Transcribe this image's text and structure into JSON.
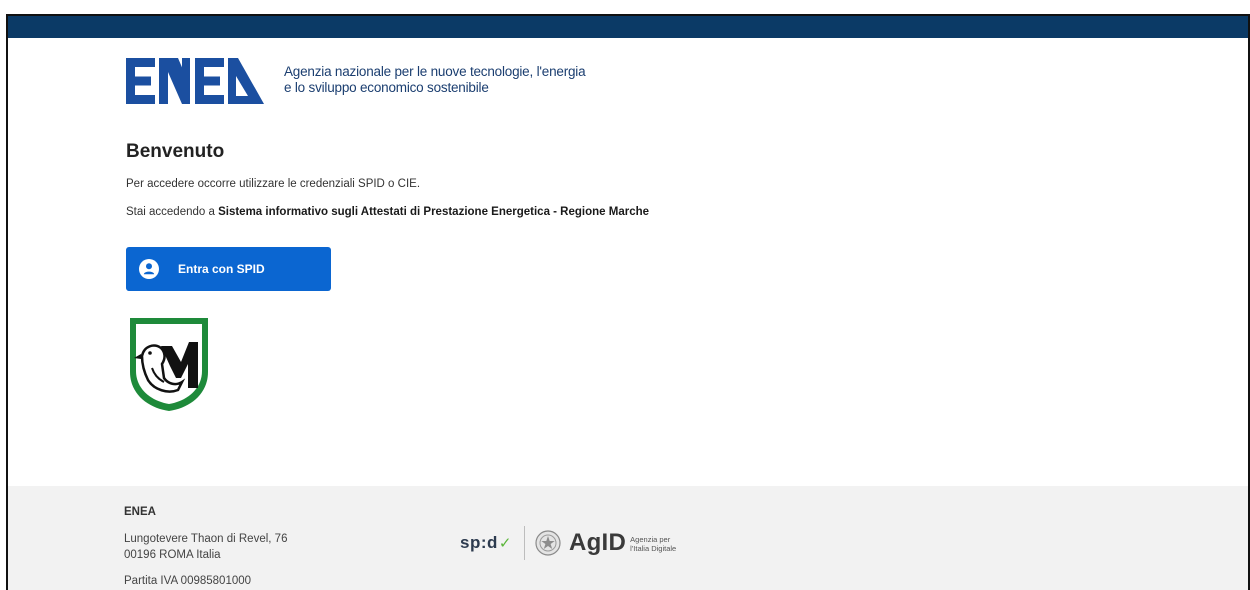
{
  "header": {
    "logo_text": "ENEA",
    "tagline_line1": "Agenzia nazionale per le nuove tecnologie, l'energia",
    "tagline_line2": "e lo sviluppo economico sostenibile"
  },
  "main": {
    "title": "Benvenuto",
    "instructions": "Per accedere occorre utilizzare le credenziali SPID o CIE.",
    "accessing_prefix": "Stai accedendo a",
    "accessing_target": "Sistema informativo sugli Attestati di Prestazione Energetica - Regione Marche",
    "spid_button_label": "Entra con SPID"
  },
  "footer": {
    "org_name": "ENEA",
    "address_line1": "Lungotevere Thaon di Revel, 76",
    "address_line2": "00196 ROMA Italia",
    "vat": "Partita IVA 00985801000",
    "spid_logo_text": "sp:d",
    "agid_logo_text": "AgID",
    "agid_sub_line1": "Agenzia per",
    "agid_sub_line2": "l'Italia Digitale"
  },
  "colors": {
    "topbar": "#0b3a66",
    "brand_blue": "#1b4fa0",
    "button_blue": "#0b66d1",
    "footer_bg": "#f2f2f2",
    "region_green": "#1e8a3a"
  },
  "icons": [
    "enea-logo",
    "user-icon",
    "regione-marche-logo",
    "spid-check-icon",
    "repubblica-emblem-icon"
  ]
}
